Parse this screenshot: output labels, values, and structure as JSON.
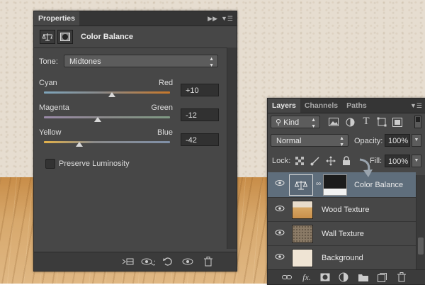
{
  "properties": {
    "tab_label": "Properties",
    "panel_title": "Color Balance",
    "tone": {
      "label": "Tone:",
      "value": "Midtones"
    },
    "sliders": [
      {
        "left": "Cyan",
        "right": "Red",
        "value": "+10",
        "level": 0.55
      },
      {
        "left": "Magenta",
        "right": "Green",
        "value": "-12",
        "level": 0.44
      },
      {
        "left": "Yellow",
        "right": "Blue",
        "value": "-42",
        "level": 0.29
      }
    ],
    "preserve_luminosity": {
      "label": "Preserve Luminosity",
      "checked": false
    },
    "footer_icons": [
      "clip-to-layer-icon",
      "view-previous-state-icon",
      "reset-icon",
      "visibility-icon",
      "delete-icon"
    ]
  },
  "layers": {
    "tabs": [
      "Layers",
      "Channels",
      "Paths"
    ],
    "filter_kind": "Kind",
    "filter_icons": [
      "pixel-filter-icon",
      "adjustment-filter-icon",
      "type-filter-icon",
      "shape-filter-icon",
      "smart-object-filter-icon"
    ],
    "blend_mode": "Normal",
    "opacity_label": "Opacity:",
    "opacity_value": "100%",
    "lock_label": "Lock:",
    "fill_label": "Fill:",
    "fill_value": "100%",
    "rows": [
      {
        "name": "Color Balance",
        "type": "adjustment",
        "selected": true
      },
      {
        "name": "Wood Texture",
        "type": "wood",
        "selected": false
      },
      {
        "name": "Wall Texture",
        "type": "wall",
        "selected": false
      },
      {
        "name": "Background",
        "type": "plain",
        "selected": false
      }
    ],
    "footer_icons": [
      "link-layers-icon",
      "fx-icon",
      "add-mask-icon",
      "adjustment-layer-icon",
      "group-icon",
      "new-layer-icon",
      "delete-layer-icon"
    ]
  },
  "colors": {
    "panel_bg": "#474747",
    "selected_row": "#5f6e7c",
    "cyan_red_track": "#c8782a",
    "yellow_blue_track": "#e4b24a"
  }
}
